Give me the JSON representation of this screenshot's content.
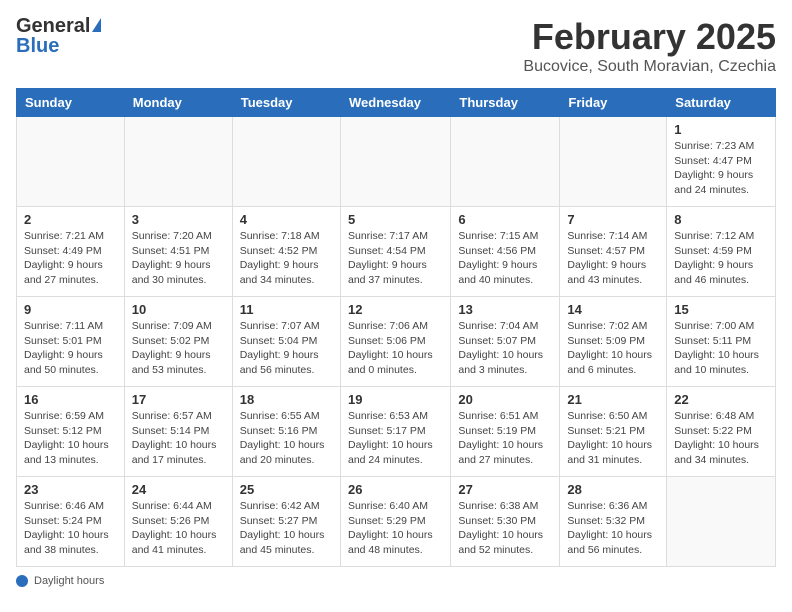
{
  "header": {
    "logo_general": "General",
    "logo_blue": "Blue",
    "month": "February 2025",
    "location": "Bucovice, South Moravian, Czechia"
  },
  "weekdays": [
    "Sunday",
    "Monday",
    "Tuesday",
    "Wednesday",
    "Thursday",
    "Friday",
    "Saturday"
  ],
  "weeks": [
    [
      {
        "day": "",
        "detail": ""
      },
      {
        "day": "",
        "detail": ""
      },
      {
        "day": "",
        "detail": ""
      },
      {
        "day": "",
        "detail": ""
      },
      {
        "day": "",
        "detail": ""
      },
      {
        "day": "",
        "detail": ""
      },
      {
        "day": "1",
        "detail": "Sunrise: 7:23 AM\nSunset: 4:47 PM\nDaylight: 9 hours and 24 minutes."
      }
    ],
    [
      {
        "day": "2",
        "detail": "Sunrise: 7:21 AM\nSunset: 4:49 PM\nDaylight: 9 hours and 27 minutes."
      },
      {
        "day": "3",
        "detail": "Sunrise: 7:20 AM\nSunset: 4:51 PM\nDaylight: 9 hours and 30 minutes."
      },
      {
        "day": "4",
        "detail": "Sunrise: 7:18 AM\nSunset: 4:52 PM\nDaylight: 9 hours and 34 minutes."
      },
      {
        "day": "5",
        "detail": "Sunrise: 7:17 AM\nSunset: 4:54 PM\nDaylight: 9 hours and 37 minutes."
      },
      {
        "day": "6",
        "detail": "Sunrise: 7:15 AM\nSunset: 4:56 PM\nDaylight: 9 hours and 40 minutes."
      },
      {
        "day": "7",
        "detail": "Sunrise: 7:14 AM\nSunset: 4:57 PM\nDaylight: 9 hours and 43 minutes."
      },
      {
        "day": "8",
        "detail": "Sunrise: 7:12 AM\nSunset: 4:59 PM\nDaylight: 9 hours and 46 minutes."
      }
    ],
    [
      {
        "day": "9",
        "detail": "Sunrise: 7:11 AM\nSunset: 5:01 PM\nDaylight: 9 hours and 50 minutes."
      },
      {
        "day": "10",
        "detail": "Sunrise: 7:09 AM\nSunset: 5:02 PM\nDaylight: 9 hours and 53 minutes."
      },
      {
        "day": "11",
        "detail": "Sunrise: 7:07 AM\nSunset: 5:04 PM\nDaylight: 9 hours and 56 minutes."
      },
      {
        "day": "12",
        "detail": "Sunrise: 7:06 AM\nSunset: 5:06 PM\nDaylight: 10 hours and 0 minutes."
      },
      {
        "day": "13",
        "detail": "Sunrise: 7:04 AM\nSunset: 5:07 PM\nDaylight: 10 hours and 3 minutes."
      },
      {
        "day": "14",
        "detail": "Sunrise: 7:02 AM\nSunset: 5:09 PM\nDaylight: 10 hours and 6 minutes."
      },
      {
        "day": "15",
        "detail": "Sunrise: 7:00 AM\nSunset: 5:11 PM\nDaylight: 10 hours and 10 minutes."
      }
    ],
    [
      {
        "day": "16",
        "detail": "Sunrise: 6:59 AM\nSunset: 5:12 PM\nDaylight: 10 hours and 13 minutes."
      },
      {
        "day": "17",
        "detail": "Sunrise: 6:57 AM\nSunset: 5:14 PM\nDaylight: 10 hours and 17 minutes."
      },
      {
        "day": "18",
        "detail": "Sunrise: 6:55 AM\nSunset: 5:16 PM\nDaylight: 10 hours and 20 minutes."
      },
      {
        "day": "19",
        "detail": "Sunrise: 6:53 AM\nSunset: 5:17 PM\nDaylight: 10 hours and 24 minutes."
      },
      {
        "day": "20",
        "detail": "Sunrise: 6:51 AM\nSunset: 5:19 PM\nDaylight: 10 hours and 27 minutes."
      },
      {
        "day": "21",
        "detail": "Sunrise: 6:50 AM\nSunset: 5:21 PM\nDaylight: 10 hours and 31 minutes."
      },
      {
        "day": "22",
        "detail": "Sunrise: 6:48 AM\nSunset: 5:22 PM\nDaylight: 10 hours and 34 minutes."
      }
    ],
    [
      {
        "day": "23",
        "detail": "Sunrise: 6:46 AM\nSunset: 5:24 PM\nDaylight: 10 hours and 38 minutes."
      },
      {
        "day": "24",
        "detail": "Sunrise: 6:44 AM\nSunset: 5:26 PM\nDaylight: 10 hours and 41 minutes."
      },
      {
        "day": "25",
        "detail": "Sunrise: 6:42 AM\nSunset: 5:27 PM\nDaylight: 10 hours and 45 minutes."
      },
      {
        "day": "26",
        "detail": "Sunrise: 6:40 AM\nSunset: 5:29 PM\nDaylight: 10 hours and 48 minutes."
      },
      {
        "day": "27",
        "detail": "Sunrise: 6:38 AM\nSunset: 5:30 PM\nDaylight: 10 hours and 52 minutes."
      },
      {
        "day": "28",
        "detail": "Sunrise: 6:36 AM\nSunset: 5:32 PM\nDaylight: 10 hours and 56 minutes."
      },
      {
        "day": "",
        "detail": ""
      }
    ]
  ],
  "footer": {
    "legend_label": "Daylight hours"
  }
}
